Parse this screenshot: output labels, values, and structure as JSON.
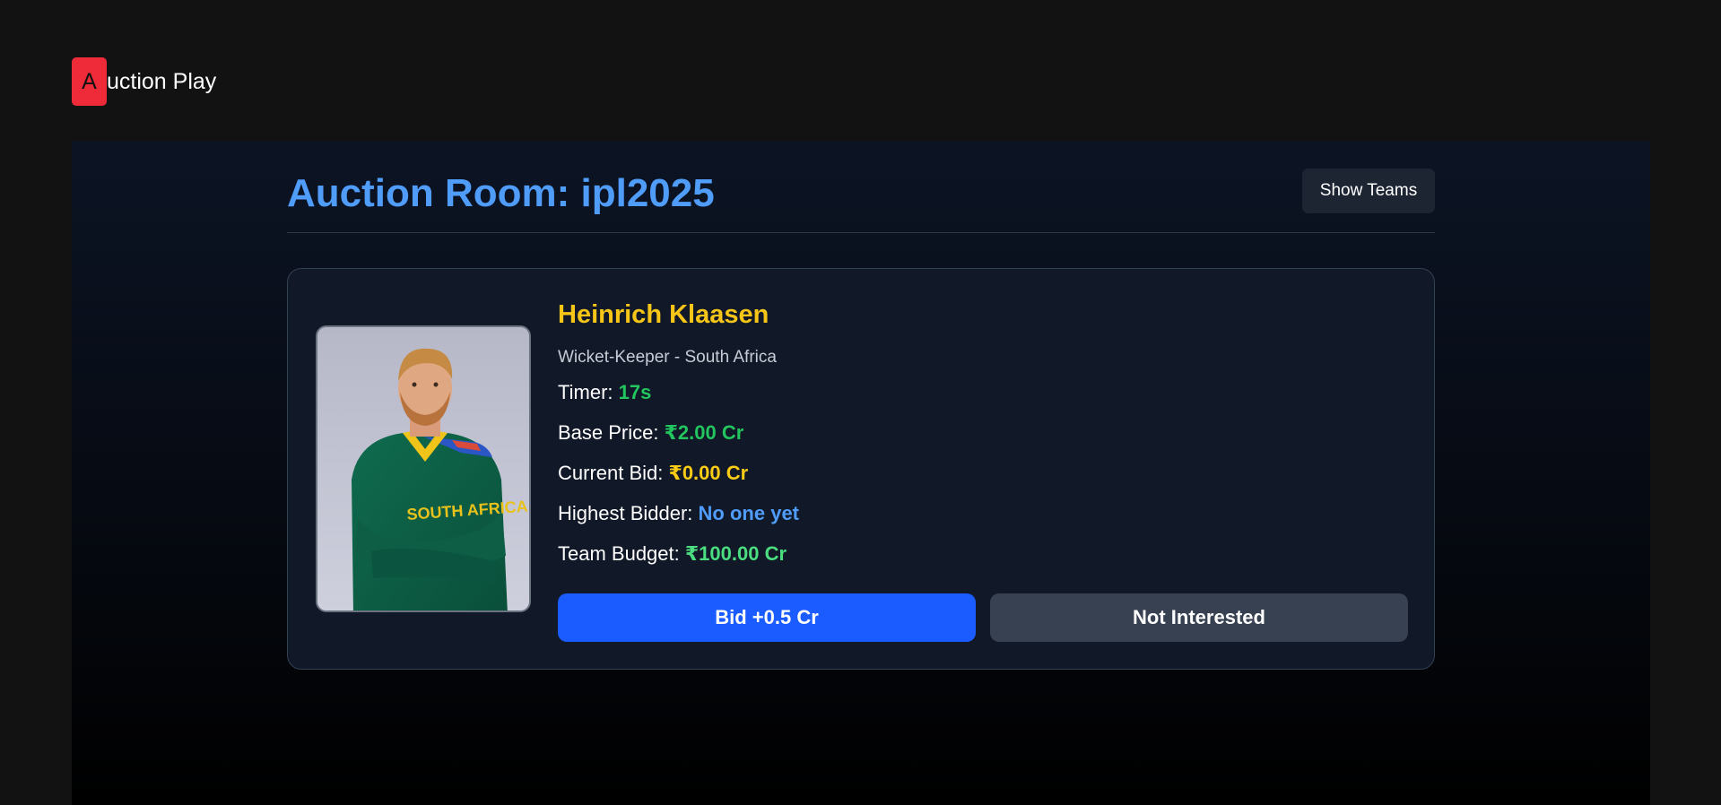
{
  "header": {
    "logo_letter": "A",
    "logo_text": "uction Play"
  },
  "room": {
    "title": "Auction Room: ipl2025",
    "show_teams_label": "Show Teams"
  },
  "player": {
    "name": "Heinrich Klaasen",
    "role_country": "Wicket-Keeper - South Africa",
    "photo_icon": "player-portrait"
  },
  "stats": {
    "timer_label": "Timer:",
    "timer_value": "17s",
    "base_price_label": "Base Price:",
    "base_price_value": "₹2.00 Cr",
    "current_bid_label": "Current Bid:",
    "current_bid_value": "₹0.00 Cr",
    "highest_bidder_label": "Highest Bidder:",
    "highest_bidder_value": "No one yet",
    "team_budget_label": "Team Budget:",
    "team_budget_value": "₹100.00 Cr"
  },
  "actions": {
    "bid_label": "Bid +0.5 Cr",
    "not_interested_label": "Not Interested"
  },
  "colors": {
    "logo": "#ef2b3a",
    "title": "#4f9cf9",
    "player_name": "#f5c518",
    "bid_button": "#1a5cff",
    "not_interested_button": "#374151"
  }
}
